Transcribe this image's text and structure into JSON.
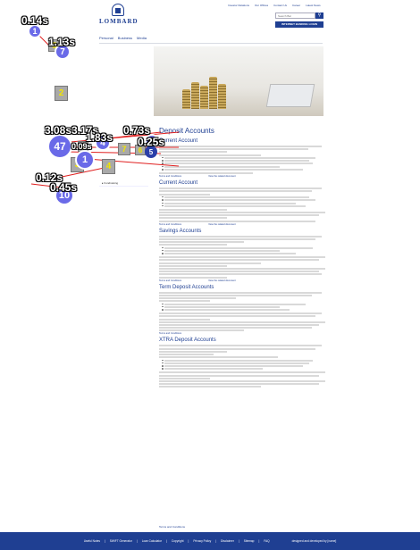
{
  "header": {
    "top_links": [
      "Investor Relations",
      "Our Offices",
      "Contact Us",
      "Career",
      "Latest News"
    ],
    "logo_text": "LOMBARD",
    "search_placeholder": "Search Bar",
    "search_icon": "search-icon",
    "internet_banking_label": "INTERNET BANKING LOGIN",
    "nav": [
      "Personal",
      "Business",
      "Media"
    ]
  },
  "overlay": {
    "times": [
      "0.14s",
      "1.13s",
      "3.08s",
      "3.17s",
      "1.83s",
      "0.73s",
      "0.25s",
      "0.12s",
      "0.45s",
      "0.09s"
    ],
    "circles": [
      "1",
      "7",
      "47",
      "4",
      "1",
      "1",
      "10",
      "5"
    ],
    "squares": [
      "2",
      "3",
      "4",
      "5",
      "6",
      "7",
      "8"
    ],
    "circle_color": "#6a6ae8",
    "square_color": "#a9a9a9"
  },
  "sidebar": {
    "items": [
      "Fundraising"
    ]
  },
  "content": {
    "page_title": "Deposit Accounts",
    "sections": [
      {
        "title": "Current Account"
      },
      {
        "title": "Savings Accounts"
      },
      {
        "title": "Term Deposit Accounts"
      },
      {
        "title": "XTRA Deposit Accounts"
      }
    ],
    "terms_link": "Terms and Conditions",
    "more_info_link": "View the related document"
  },
  "footer": {
    "links": [
      "Useful Notes",
      "SWIFT Generator",
      "Loan Calculator",
      "Copyright",
      "Privacy Policy",
      "Disclaimer",
      "Sitemap",
      "FAQ",
      "designed and developed by [name]"
    ]
  }
}
